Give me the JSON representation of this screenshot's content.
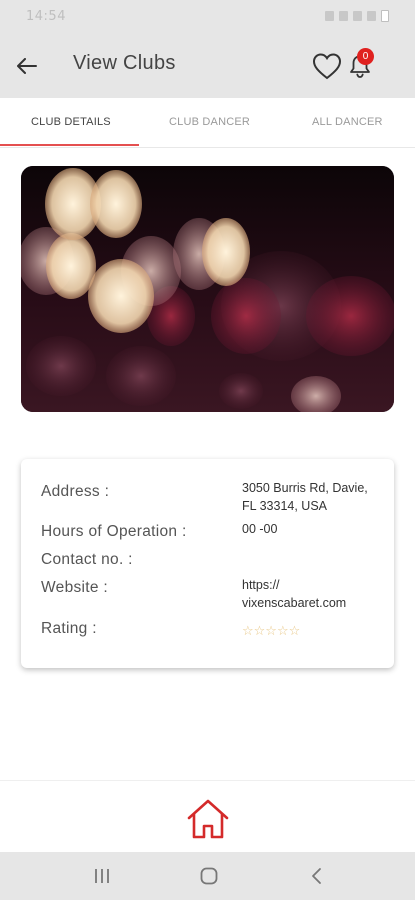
{
  "status_bar": {
    "time": "14:54"
  },
  "app_bar": {
    "title": "View Clubs",
    "notification_count": "0"
  },
  "tabs": [
    {
      "label": "CLUB DETAILS",
      "active": true
    },
    {
      "label": "CLUB DANCER",
      "active": false
    },
    {
      "label": "ALL DANCER",
      "active": false
    }
  ],
  "details": {
    "address_label": "Address :",
    "address_value": "3050 Burris Rd, Davie, FL 33314, USA",
    "hours_label": "Hours of Operation :",
    "hours_value": "00 -00",
    "contact_label": "Contact no. :",
    "contact_value": "",
    "website_label": "Website :",
    "website_value": "https:// vixenscabaret.com",
    "rating_label": "Rating :",
    "rating_stars": "☆☆☆☆☆",
    "rating": 0
  },
  "colors": {
    "accent": "#e45050",
    "home_icon": "#d42a2a",
    "badge": "#e0211f"
  },
  "icons": [
    "back-arrow-icon",
    "heart-icon",
    "bell-icon",
    "home-icon",
    "recent-apps-icon",
    "home-circle-icon",
    "back-chevron-icon"
  ]
}
